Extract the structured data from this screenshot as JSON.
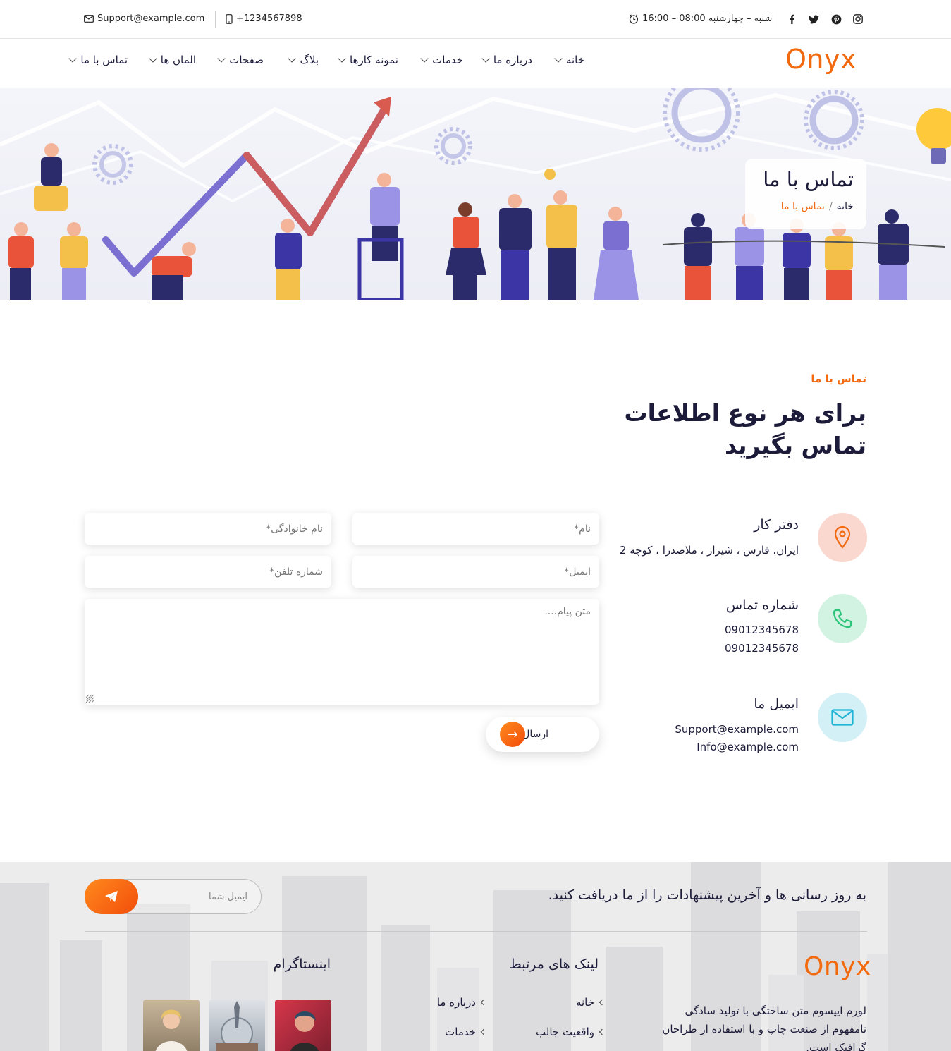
{
  "topbar": {
    "email": "Support@example.com",
    "phone": "+1234567898",
    "hours": "شنبه – چهارشنبه 08:00 – 16:00",
    "social": [
      "facebook-icon",
      "twitter-icon",
      "pinterest-icon",
      "instagram-icon"
    ]
  },
  "brand": {
    "logo": "Onyx",
    "color": "#f26a0f"
  },
  "nav": {
    "items": [
      {
        "label": "خانه"
      },
      {
        "label": "درباره ما"
      },
      {
        "label": "خدمات"
      },
      {
        "label": "نمونه کارها"
      },
      {
        "label": "بلاگ"
      },
      {
        "label": "صفحات"
      },
      {
        "label": "المان ها"
      },
      {
        "label": "تماس با ما"
      }
    ]
  },
  "hero": {
    "title": "تماس با ما",
    "breadcrumb_home": "خانه",
    "breadcrumb_sep": "/",
    "breadcrumb_current": "تماس با ما"
  },
  "contact": {
    "eyebrow": "تماس با ما",
    "heading": "برای هر نوع اطلاعات تماس بگیرید",
    "office": {
      "title": "دفتر کار",
      "address": "ایران، فارس ، شیراز ، ملاصدرا ، کوچه 2"
    },
    "phone": {
      "title": "شماره تماس",
      "line1": "09012345678",
      "line2": "09012345678"
    },
    "email": {
      "title": "ایمیل ما",
      "line1": "Support@example.com",
      "line2": "Info@example.com"
    }
  },
  "form": {
    "name_placeholder": "نام*",
    "lastname_placeholder": "نام خانوادگی*",
    "email_placeholder": "ایمیل*",
    "phone_placeholder": "شماره تلفن*",
    "message_placeholder": "متن پیام....",
    "submit_label": "ارسال پیام",
    "submit_arrow": "→"
  },
  "footer": {
    "newsletter_text": "به روز رسانی ها و آخرین پیشنهادات را از ما دریافت کنید.",
    "newsletter_placeholder": "ایمیل شما",
    "logo": "Onyx",
    "about": "لورم ایپسوم متن ساختگی با تولید سادگی نامفهوم از صنعت چاپ و با استفاده از طراحان گرافیک است.",
    "links_title": "لینک های مرتبط",
    "links": [
      {
        "label": "خانه"
      },
      {
        "label": "درباره ما"
      },
      {
        "label": "واقعیت جالب"
      },
      {
        "label": "خدمات"
      }
    ],
    "instagram_title": "اینستاگرام"
  }
}
